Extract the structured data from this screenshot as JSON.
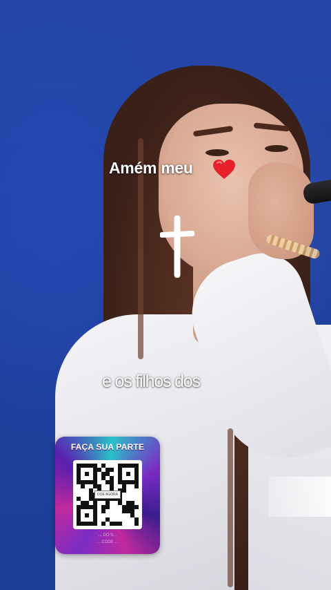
{
  "video": {
    "caption_1": "Amém meu",
    "caption_1_emoji": "heart-icon",
    "caption_2": "e os filhos dos",
    "decoration": "cross-icon"
  },
  "promo": {
    "title": "FAÇA SUA PARTE",
    "qr_center": "DOE AGORA",
    "footer_line_1": "... DO S...",
    "footer_line_2": "... CODE ..."
  },
  "colors": {
    "background": "#2142a0",
    "heart": "#e8202c",
    "card_purple": "#7a2cc4",
    "card_magenta": "#c12a9e",
    "card_cyan": "#29c1c9"
  }
}
